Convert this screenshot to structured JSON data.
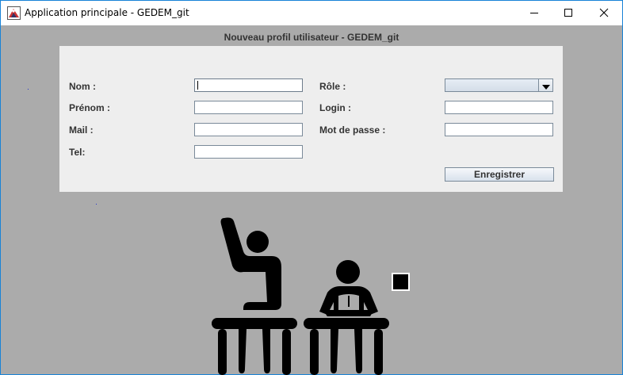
{
  "window": {
    "title": "Application principale - GEDEM_git",
    "controls": {
      "minimize": "minimize",
      "maximize": "maximize",
      "close": "close"
    }
  },
  "header": {
    "title": "Nouveau profil utilisateur - GEDEM_git"
  },
  "form": {
    "nom": {
      "label": "Nom :",
      "value": ""
    },
    "prenom": {
      "label": "Prénom :",
      "value": ""
    },
    "mail": {
      "label": "Mail :",
      "value": ""
    },
    "tel": {
      "label": "Tel:",
      "value": ""
    },
    "role": {
      "label": "Rôle :",
      "selected": ""
    },
    "login": {
      "label": "Login :",
      "value": ""
    },
    "password": {
      "label": "Mot de passe :",
      "value": ""
    },
    "save_label": "Enregistrer"
  },
  "icons": {
    "app": "java-app-icon",
    "illustration": "students-at-desks-icon"
  },
  "colors": {
    "background": "#ababab",
    "panel": "#eeeeee",
    "label": "#333333",
    "border": "#1883d7"
  }
}
